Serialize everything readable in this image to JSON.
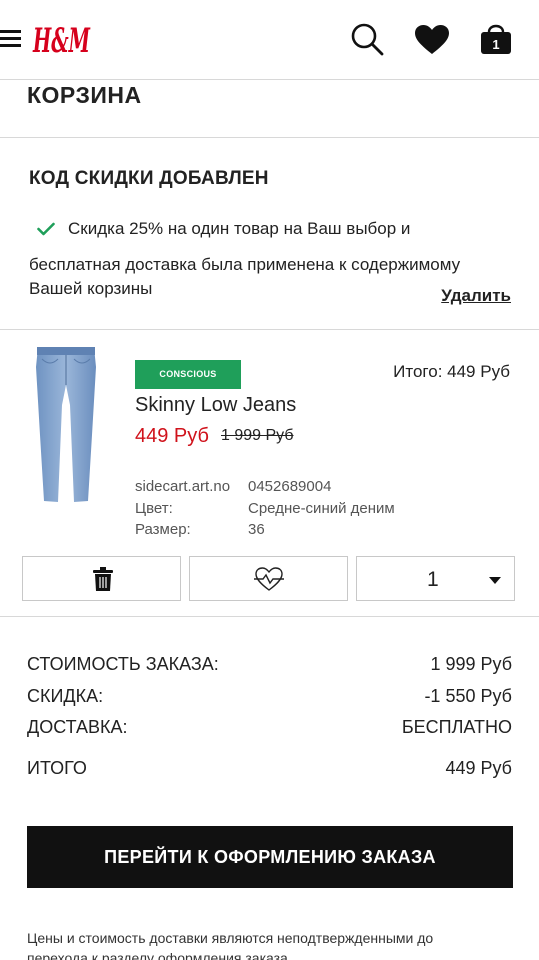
{
  "header": {
    "logo_text": "H&M",
    "cart_count": "1",
    "icons": [
      "menu-icon",
      "search-icon",
      "heart-icon",
      "shopping-bag-icon"
    ]
  },
  "page_title": "КОРЗИНА",
  "discount": {
    "heading": "КОД СКИДКИ ДОБАВЛЕН",
    "line1": "Скидка 25% на один товар на Ваш выбор и",
    "line2": "бесплатная доставка была применена к содержимому",
    "line3": "Вашей корзины",
    "remove_label": "Удалить",
    "check_color": "#1f9f5a"
  },
  "product": {
    "badge": "CONSCIOUS",
    "badge_color": "#1f9f5a",
    "total": "Итого: 449 Руб",
    "name": "Skinny Low Jeans",
    "price_sale": "449 Руб",
    "price_old": "1 999 Руб",
    "sale_color": "#d0121b",
    "attributes": [
      {
        "label": "sidecart.art.no",
        "value": "0452689004"
      },
      {
        "label": "Цвет:",
        "value": "Средне-синий деним"
      },
      {
        "label": "Размер:",
        "value": "36"
      }
    ],
    "quantity": "1"
  },
  "summary": {
    "rows": [
      {
        "label": "СТОИМОСТЬ ЗАКАЗА:",
        "value": "1 999 Руб"
      },
      {
        "label": "СКИДКА:",
        "value": "-1 550 Руб"
      },
      {
        "label": "ДОСТАВКА:",
        "value": "БЕСПЛАТНО"
      },
      {
        "label": "ИТОГО",
        "value": "449 Руб"
      }
    ]
  },
  "checkout_label": "ПЕРЕЙТИ К ОФОРМЛЕНИЮ ЗАКАЗА",
  "footnote": {
    "line1": "Цены и стоимость доставки являются неподтвержденными до",
    "line2": "перехода к разделу оформления заказа"
  }
}
